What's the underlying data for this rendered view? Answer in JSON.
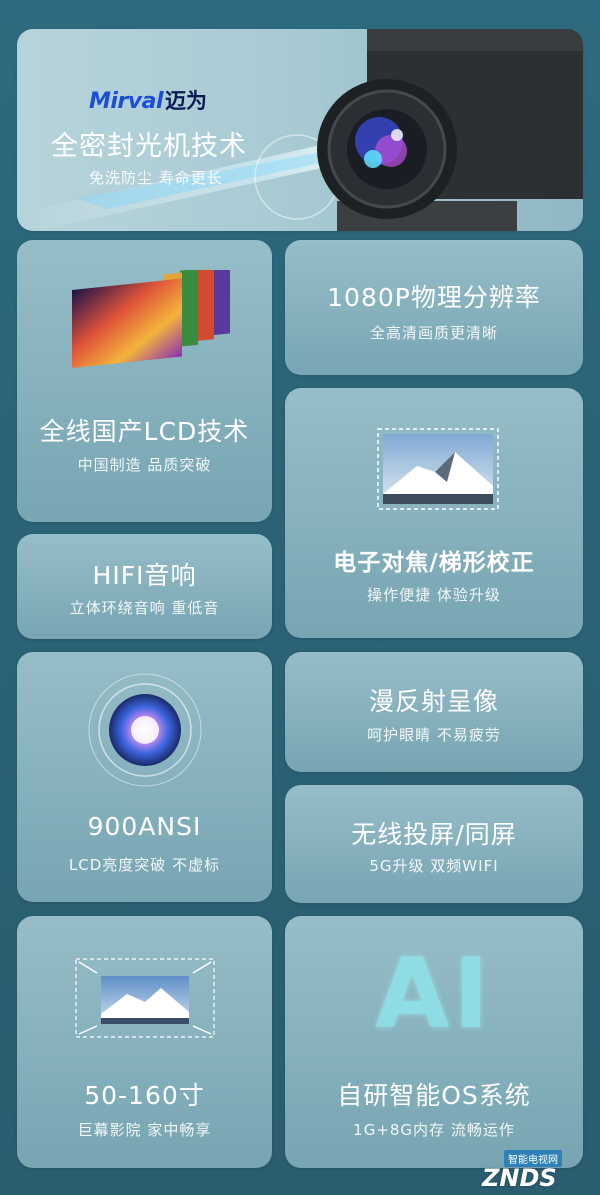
{
  "hero": {
    "brand_en": "Mirval",
    "brand_cn": "迈为",
    "title": "全密封光机技术",
    "subtitle": "免洗防尘 寿命更长"
  },
  "features": {
    "lcd": {
      "title": "全线国产LCD技术",
      "subtitle": "中国制造 品质突破"
    },
    "resolution": {
      "title": "1080P物理分辨率",
      "subtitle": "全高清画质更清晰"
    },
    "focus": {
      "title": "电子对焦/梯形校正",
      "subtitle": "操作便捷 体验升级"
    },
    "hifi": {
      "title": "HIFI音响",
      "subtitle": "立体环绕音响 重低音"
    },
    "diffuse": {
      "title": "漫反射呈像",
      "subtitle": "呵护眼睛 不易疲劳"
    },
    "brightness": {
      "title": "900ANSI",
      "subtitle": "LCD亮度突破 不虚标"
    },
    "wireless": {
      "title": "无线投屏/同屏",
      "subtitle": "5G升级 双频WIFI"
    },
    "size": {
      "title": "50-160寸",
      "subtitle": "巨幕影院 家中畅享"
    },
    "os": {
      "title": "自研智能OS系统",
      "subtitle": "1G+8G内存 流畅运作",
      "logo_text": "AI"
    }
  },
  "watermark": {
    "text": "ZNDS",
    "tag": "智能电视网"
  },
  "colors": {
    "background": "#2b6376",
    "card": "#8fb8c3",
    "brand_blue": "#1d4fd6"
  }
}
